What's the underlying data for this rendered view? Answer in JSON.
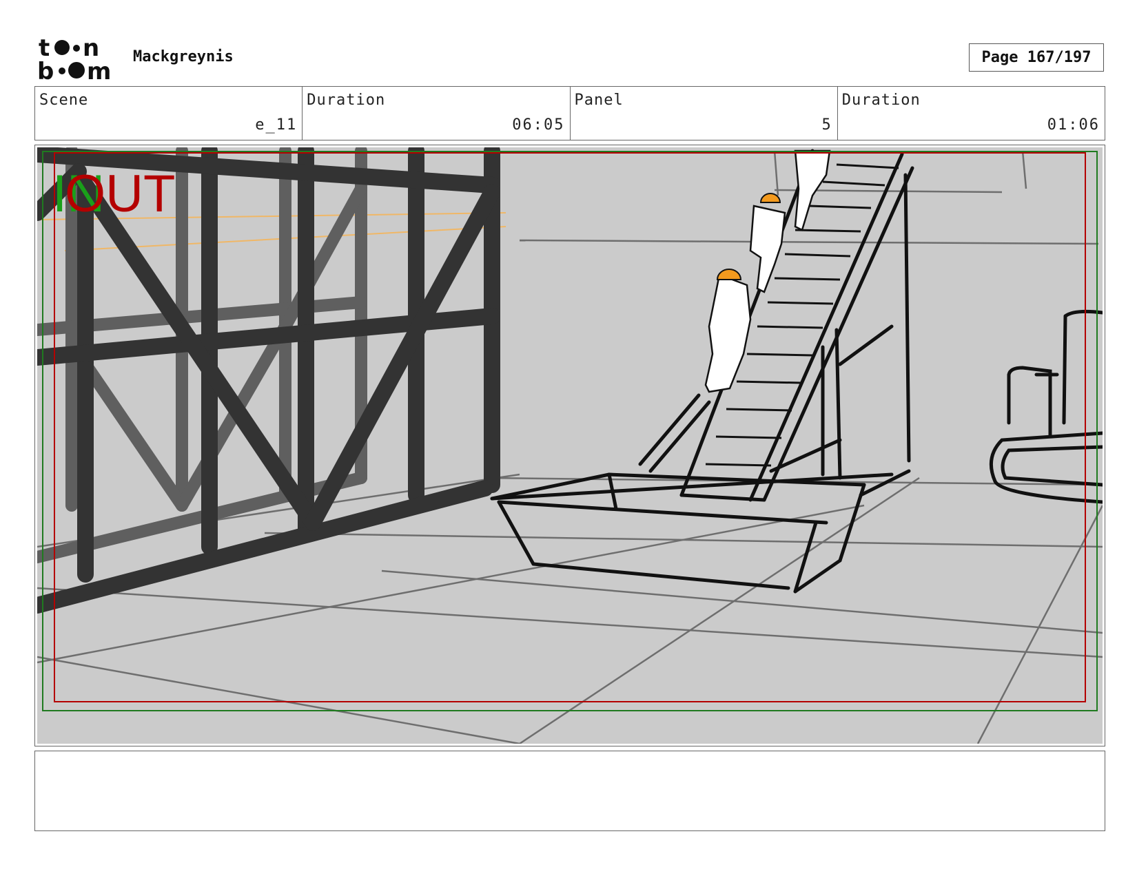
{
  "header": {
    "logo_text": "toon boom",
    "project_title": "Mackgreynis",
    "page_label": "Page 167/197"
  },
  "info": {
    "scene_label": "Scene",
    "scene_value": "e_11",
    "scene_duration_label": "Duration",
    "scene_duration_value": "06:05",
    "panel_label": "Panel",
    "panel_value": "5",
    "panel_duration_label": "Duration",
    "panel_duration_value": "01:06"
  },
  "panel": {
    "overlay_in": "IN",
    "overlay_out": "OUT",
    "colors": {
      "background": "#cbcbcb",
      "scaffold": "#333333",
      "scaffold_far": "#5f5f5f",
      "helmet": "#f39a1e",
      "in_green": "#1aa01a",
      "out_red": "#b40000"
    }
  },
  "notes": {
    "text": ""
  }
}
